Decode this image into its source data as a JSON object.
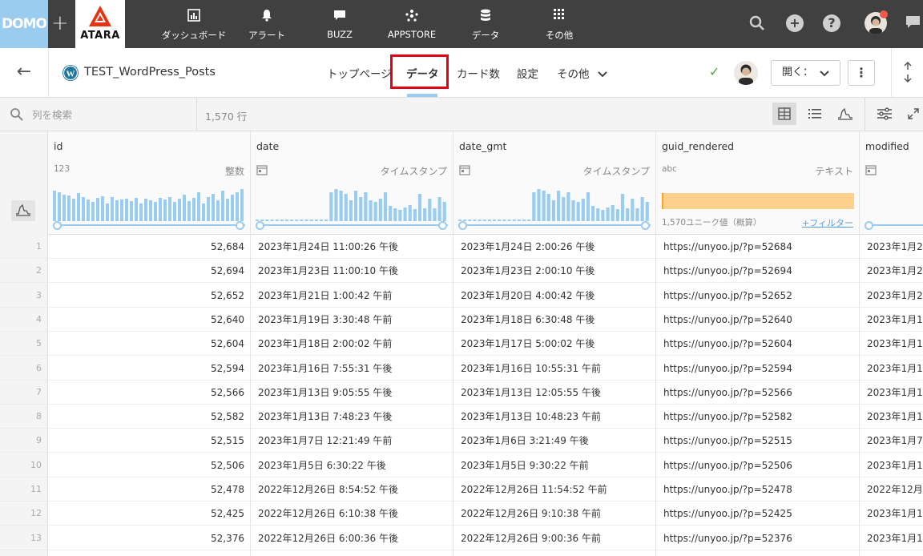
{
  "topnav": {
    "domo_logo": "DOMO",
    "atara": "ATARA",
    "items": [
      {
        "label": "ダッシュボード",
        "icon": "dashboard-icon"
      },
      {
        "label": "アラート",
        "icon": "bell-icon"
      },
      {
        "label": "BUZZ",
        "icon": "chat-icon"
      },
      {
        "label": "APPSTORE",
        "icon": "appstore-icon"
      },
      {
        "label": "データ",
        "icon": "database-icon"
      },
      {
        "label": "その他",
        "icon": "grid-icon"
      }
    ],
    "colors": {
      "bg": "#404040",
      "domo": "#99ccee",
      "atara_red": "#e63312"
    }
  },
  "header": {
    "dataset_title": "TEST_WordPress_Posts",
    "tabs": [
      "トップページ",
      "データ",
      "カード数",
      "設定",
      "その他"
    ],
    "active_tab": "データ",
    "open_button": "開く：",
    "highlight_color": "#e60012"
  },
  "toolbar": {
    "search_placeholder": "列を検索",
    "row_count": "1,570 行"
  },
  "columns": [
    {
      "name": "id",
      "type_icon": "123",
      "type": "整数"
    },
    {
      "name": "date",
      "type_icon": "calendar-icon",
      "type": "タイムスタンプ"
    },
    {
      "name": "date_gmt",
      "type_icon": "calendar-icon",
      "type": "タイムスタンプ"
    },
    {
      "name": "guid_rendered",
      "type_icon": "abc",
      "type": "テキスト",
      "unique": "1,570ユニーク値（概算）",
      "filter": "+フィルター"
    },
    {
      "name": "modified",
      "type_icon": "calendar-icon",
      "type": ""
    }
  ],
  "rows": [
    {
      "n": "1",
      "id": "52,684",
      "date": "2023年1月24日 11:00:26 午後",
      "date_gmt": "2023年1月24日 2:00:26 午後",
      "guid": "https://unyoo.jp/?p=52684",
      "modified": "2023年1月2"
    },
    {
      "n": "2",
      "id": "52,694",
      "date": "2023年1月23日 11:00:10 午後",
      "date_gmt": "2023年1月23日 2:00:10 午後",
      "guid": "https://unyoo.jp/?p=52694",
      "modified": "2023年1月2"
    },
    {
      "n": "3",
      "id": "52,652",
      "date": "2023年1月21日 1:00:42 午前",
      "date_gmt": "2023年1月20日 4:00:42 午後",
      "guid": "https://unyoo.jp/?p=52652",
      "modified": "2023年1月2"
    },
    {
      "n": "4",
      "id": "52,640",
      "date": "2023年1月19日 3:30:48 午前",
      "date_gmt": "2023年1月18日 6:30:48 午後",
      "guid": "https://unyoo.jp/?p=52640",
      "modified": "2023年1月1"
    },
    {
      "n": "5",
      "id": "52,604",
      "date": "2023年1月18日 2:00:02 午前",
      "date_gmt": "2023年1月17日 5:00:02 午後",
      "guid": "https://unyoo.jp/?p=52604",
      "modified": "2023年1月1"
    },
    {
      "n": "6",
      "id": "52,594",
      "date": "2023年1月16日 7:55:31 午後",
      "date_gmt": "2023年1月16日 10:55:31 午前",
      "guid": "https://unyoo.jp/?p=52594",
      "modified": "2023年1月1"
    },
    {
      "n": "7",
      "id": "52,566",
      "date": "2023年1月13日 9:05:55 午後",
      "date_gmt": "2023年1月13日 12:05:55 午後",
      "guid": "https://unyoo.jp/?p=52566",
      "modified": "2023年1月1"
    },
    {
      "n": "8",
      "id": "52,582",
      "date": "2023年1月13日 7:48:23 午後",
      "date_gmt": "2023年1月13日 10:48:23 午前",
      "guid": "https://unyoo.jp/?p=52582",
      "modified": "2023年1月1"
    },
    {
      "n": "9",
      "id": "52,515",
      "date": "2023年1月7日 12:21:49 午前",
      "date_gmt": "2023年1月6日 3:21:49 午後",
      "guid": "https://unyoo.jp/?p=52515",
      "modified": "2023年1月7"
    },
    {
      "n": "10",
      "id": "52,506",
      "date": "2023年1月5日 6:30:22 午後",
      "date_gmt": "2023年1月5日 9:30:22 午前",
      "guid": "https://unyoo.jp/?p=52506",
      "modified": "2023年1月1"
    },
    {
      "n": "11",
      "id": "52,478",
      "date": "2022年12月26日 8:54:52 午後",
      "date_gmt": "2022年12月26日 11:54:52 午前",
      "guid": "https://unyoo.jp/?p=52478",
      "modified": "2022年12月"
    },
    {
      "n": "12",
      "id": "52,425",
      "date": "2022年12月26日 6:10:38 午後",
      "date_gmt": "2022年12月26日 9:10:38 午前",
      "guid": "https://unyoo.jp/?p=52425",
      "modified": "2023年1月1"
    },
    {
      "n": "13",
      "id": "52,376",
      "date": "2022年12月26日 6:00:36 午後",
      "date_gmt": "2022年12月26日 9:00:36 午前",
      "guid": "https://unyoo.jp/?p=52376",
      "modified": "2023年1月1"
    }
  ]
}
